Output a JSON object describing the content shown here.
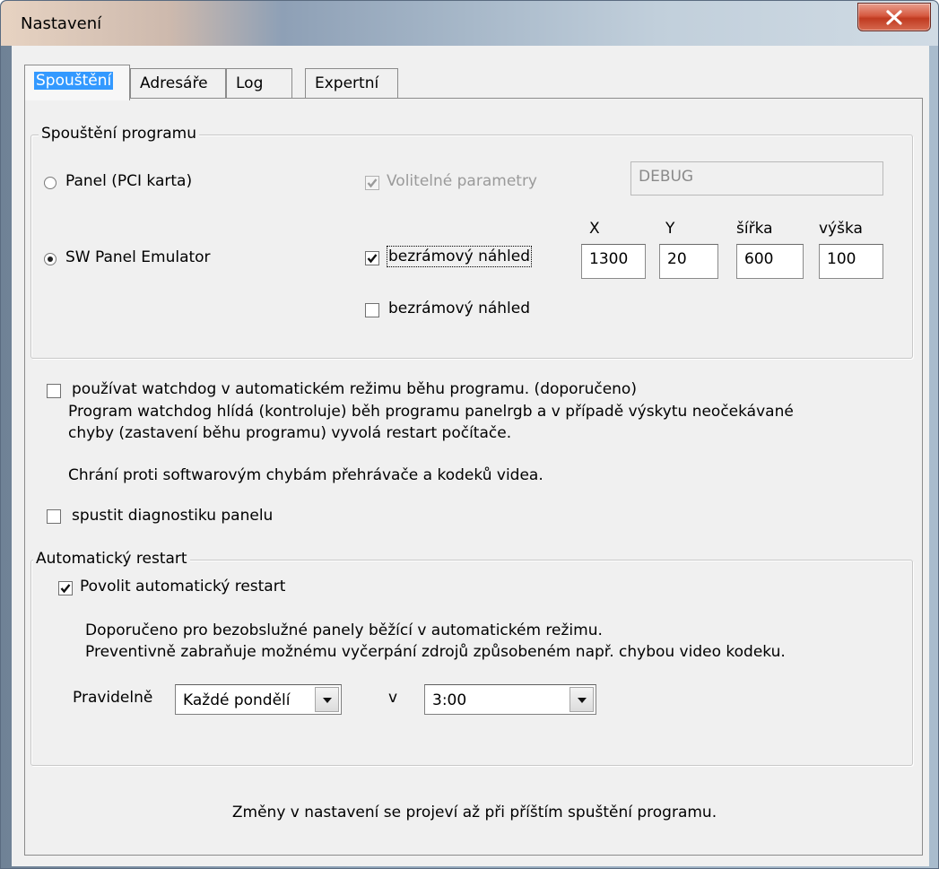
{
  "window": {
    "title": "Nastavení"
  },
  "tabs": [
    {
      "label": "Spouštění",
      "active": true
    },
    {
      "label": "Adresáře",
      "active": false
    },
    {
      "label": "Log",
      "active": false
    },
    {
      "label": "Expertní",
      "active": false
    }
  ],
  "launch_group": {
    "legend": "Spouštění programu",
    "radio_panel": {
      "label": "Panel (PCI karta)",
      "checked": false
    },
    "radio_emulator": {
      "label": "SW Panel Emulator",
      "checked": true
    },
    "optional_params": {
      "label": "Volitelné parametry",
      "checked": true,
      "enabled": false
    },
    "params_value": "DEBUG",
    "borderless_1": {
      "label": "bezrámový náhled",
      "checked": true
    },
    "borderless_2": {
      "label": "bezrámový náhled",
      "checked": false
    },
    "coords": {
      "x_label": "X",
      "x_value": "1300",
      "y_label": "Y",
      "y_value": "20",
      "w_label": "šířka",
      "w_value": "600",
      "h_label": "výška",
      "h_value": "100"
    }
  },
  "watchdog": {
    "label": "používat watchdog v automatickém režimu běhu programu. (doporučeno)",
    "checked": false,
    "desc_line1": "Program watchdog hlídá (kontroluje) běh programu panelrgb a v případě výskytu neočekávané",
    "desc_line2": "chyby (zastavení běhu programu) vyvolá restart počítače.",
    "desc_line3": "Chrání proti softwarovým chybám přehrávače a kodeků videa."
  },
  "diagnostics": {
    "label": "spustit diagnostiku panelu",
    "checked": false
  },
  "restart_group": {
    "legend": "Automatický restart",
    "enable": {
      "label": "Povolit automatický restart",
      "checked": true
    },
    "note_line1": "Doporučeno pro bezobslužné panely běžící v automatickém režimu.",
    "note_line2": "Preventivně zabraňuje možnému vyčerpání zdrojů způsobeném např. chybou video kodeku.",
    "schedule_label": "Pravidelně",
    "day_value": "Každé pondělí",
    "at_label": "v",
    "time_value": "3:00"
  },
  "footer_note": "Změny v nastavení se projeví až při příštím spuštění programu.",
  "colors": {
    "selection": "#3399ff",
    "close_button": "#c8452c"
  }
}
